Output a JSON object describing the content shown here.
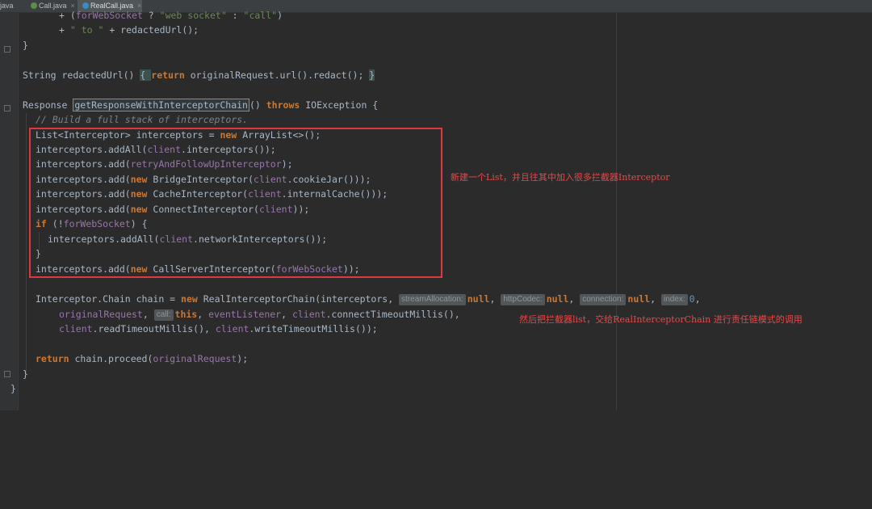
{
  "tabs": [
    {
      "label": "java",
      "active": false,
      "icon_name": "java-file-icon"
    },
    {
      "label": "Call.java",
      "active": false,
      "icon_name": "java-interface-icon"
    },
    {
      "label": "RealCall.java",
      "active": true,
      "icon_name": "java-class-icon"
    }
  ],
  "code": {
    "l1": {
      "t1": "+ (",
      "t2": "forWebSocket",
      "t3": " ? ",
      "t4": "\"web socket\"",
      "t5": " : ",
      "t6": "\"call\"",
      "t7": ")"
    },
    "l2": {
      "t1": "+ ",
      "t2": "\" to \"",
      "t3": " + redactedUrl();"
    },
    "l3": {
      "t1": "}"
    },
    "l4": {
      "t1": "String",
      "t2": " redactedUrl() ",
      "t3": "{ ",
      "t4": "return",
      "t5": " originalRequest.url().redact(); ",
      "t6": "}"
    },
    "l5": {
      "t1": "Response",
      "t2": " ",
      "t3": "getResponseWithInterceptorChain",
      "t4": "() ",
      "t5": "throws",
      "t6": " IOException {"
    },
    "l6": {
      "t1": "// Build a full stack of interceptors."
    },
    "l7": {
      "t1": "List<Interceptor> interceptors = ",
      "t2": "new",
      "t3": " ArrayList<>();"
    },
    "l8": {
      "t1": "interceptors.addAll(",
      "t2": "client",
      "t3": ".interceptors());"
    },
    "l9": {
      "t1": "interceptors.add(",
      "t2": "retryAndFollowUpInterceptor",
      "t3": ");"
    },
    "l10": {
      "t1": "interceptors.add(",
      "t2": "new",
      "t3": " BridgeInterceptor(",
      "t4": "client",
      "t5": ".cookieJar()));"
    },
    "l11": {
      "t1": "interceptors.add(",
      "t2": "new",
      "t3": " CacheInterceptor(",
      "t4": "client",
      "t5": ".internalCache()));"
    },
    "l12": {
      "t1": "interceptors.add(",
      "t2": "new",
      "t3": " ConnectInterceptor(",
      "t4": "client",
      "t5": "));"
    },
    "l13": {
      "t1": "if",
      "t2": " (!",
      "t3": "forWebSocket",
      "t4": ") {"
    },
    "l14": {
      "t1": "interceptors.addAll(",
      "t2": "client",
      "t3": ".networkInterceptors());"
    },
    "l15": {
      "t1": "}"
    },
    "l16": {
      "t1": "interceptors.add(",
      "t2": "new",
      "t3": " CallServerInterceptor(",
      "t4": "forWebSocket",
      "t5": "));"
    },
    "l17": {
      "t1": "Interceptor.Chain chain = ",
      "t2": "new",
      "t3": " RealInterceptorChain(interceptors, ",
      "h1": "streamAllocation:",
      "t4": "null",
      "t5": ", ",
      "h2": "httpCodec:",
      "t6": "null",
      "t7": ", ",
      "h3": "connection:",
      "t8": "null",
      "t9": ", ",
      "h4": "index:",
      "t10": "0",
      "t11": ","
    },
    "l18": {
      "t1": "originalRequest",
      "t2": ", ",
      "h1": "call:",
      "t3": "this",
      "t4": ", ",
      "t5": "eventListener",
      "t6": ", ",
      "t7": "client",
      "t8": ".connectTimeoutMillis(),"
    },
    "l19": {
      "t1": "client",
      "t2": ".readTimeoutMillis(), ",
      "t3": "client",
      "t4": ".writeTimeoutMillis());"
    },
    "l20": {
      "t1": "return",
      "t2": " chain.proceed(",
      "t3": "originalRequest",
      "t4": ");"
    },
    "l21": {
      "t1": "}"
    },
    "l22": {
      "t1": "}"
    }
  },
  "annotations": {
    "a1": "新建一个List，并且往其中加入很多拦截器Interceptor",
    "a2": "然后把拦截器list，交给RealInterceptorChain 进行责任链模式的调用"
  },
  "colors": {
    "background": "#2b2b2b",
    "keyword": "#cc7832",
    "field": "#9876aa",
    "string": "#6a8759",
    "comment": "#808080",
    "text": "#a9b7c6",
    "annotation_red": "#e0383f"
  }
}
